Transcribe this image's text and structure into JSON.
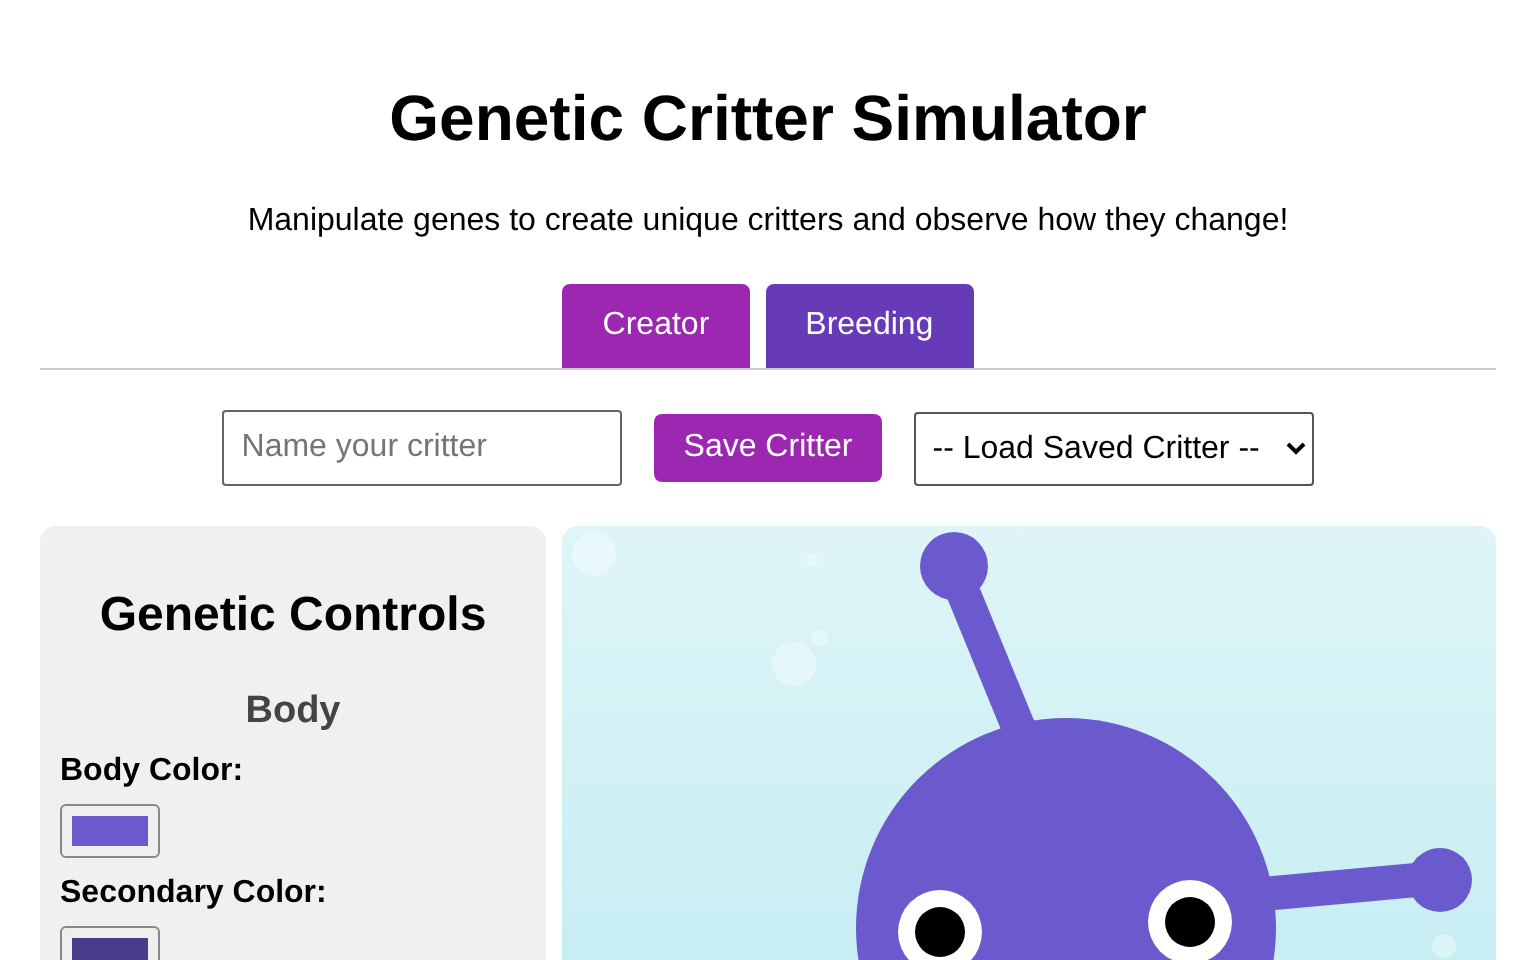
{
  "title": "Genetic Critter Simulator",
  "subtitle": "Manipulate genes to create unique critters and observe how they change!",
  "tabs": [
    {
      "label": "Creator",
      "selected": true
    },
    {
      "label": "Breeding",
      "selected": false
    }
  ],
  "name_field": {
    "placeholder": "Name your critter"
  },
  "save_button": "Save Critter",
  "load_select": "-- Load Saved Critter --",
  "controls": {
    "heading": "Genetic Controls",
    "section": "Body",
    "fields": [
      {
        "label": "Body Color:",
        "color": "#6a5acd"
      },
      {
        "label": "Secondary Color:",
        "color": "#483d8b"
      }
    ]
  }
}
